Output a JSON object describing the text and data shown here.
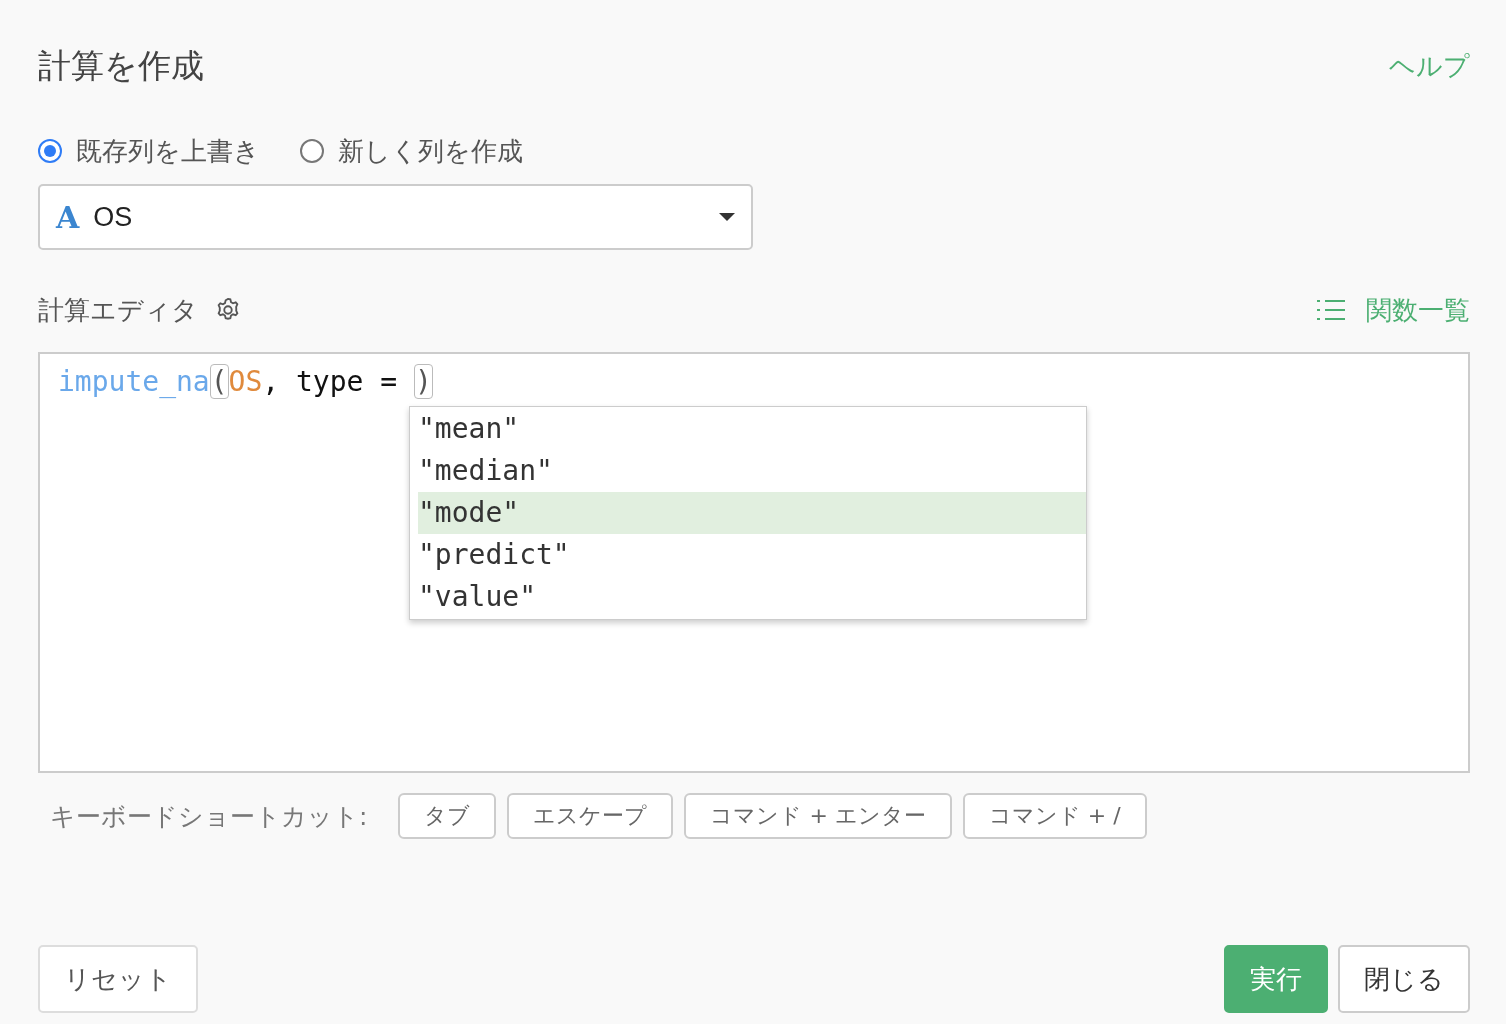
{
  "title": "計算を作成",
  "help_link": "ヘルプ",
  "mode_options": [
    {
      "label": "既存列を上書き",
      "selected": true
    },
    {
      "label": "新しく列を作成",
      "selected": false
    }
  ],
  "column_select": {
    "type_icon": "A",
    "value": "OS"
  },
  "editor": {
    "label": "計算エディタ",
    "functions_link": "関数一覧",
    "code_tokens": [
      {
        "text": "impute_na",
        "kind": "function"
      },
      {
        "text": "(",
        "kind": "bracket"
      },
      {
        "text": "OS",
        "kind": "column"
      },
      {
        "text": ", type = ",
        "kind": "plain"
      },
      {
        "text": ")",
        "kind": "bracket"
      }
    ],
    "suggestions": [
      {
        "text": "\"mean\"",
        "selected": false
      },
      {
        "text": "\"median\"",
        "selected": false
      },
      {
        "text": "\"mode\"",
        "selected": true
      },
      {
        "text": "\"predict\"",
        "selected": false
      },
      {
        "text": "\"value\"",
        "selected": false
      }
    ]
  },
  "shortcuts": {
    "label": "キーボードショートカット:",
    "keys": [
      "タブ",
      "エスケープ",
      "コマンド + エンター",
      "コマンド + /"
    ]
  },
  "buttons": {
    "reset": "リセット",
    "run": "実行",
    "close": "閉じる"
  }
}
